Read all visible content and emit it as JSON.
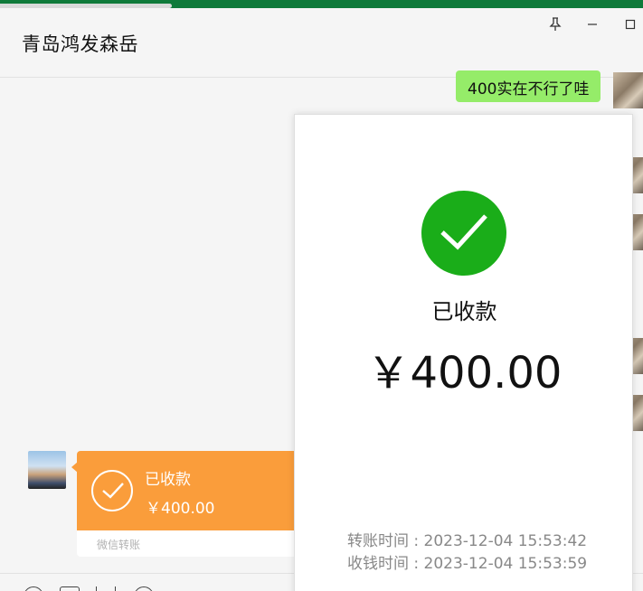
{
  "window": {
    "title": "青岛鸿发森岳",
    "controls": {
      "pin_icon": "pin-icon",
      "minimize_icon": "minimize-icon",
      "maximize_icon": "maximize-icon"
    }
  },
  "chat": {
    "outgoing_message": "400实在不行了哇",
    "transfer_card": {
      "status": "已收款",
      "amount": "￥400.00",
      "label": "微信转账",
      "color": "#fa9d3b"
    }
  },
  "receipt_popup": {
    "status": "已收款",
    "amount": "￥400.00",
    "transfer_time": "转账时间 : 2023-12-04 15:53:42",
    "receive_time": "收钱时间 : 2023-12-04 15:53:59",
    "check_color": "#1aad19"
  },
  "colors": {
    "top_accent": "#0f7a3a",
    "bubble_green": "#95ec69",
    "background": "#f5f5f5"
  }
}
